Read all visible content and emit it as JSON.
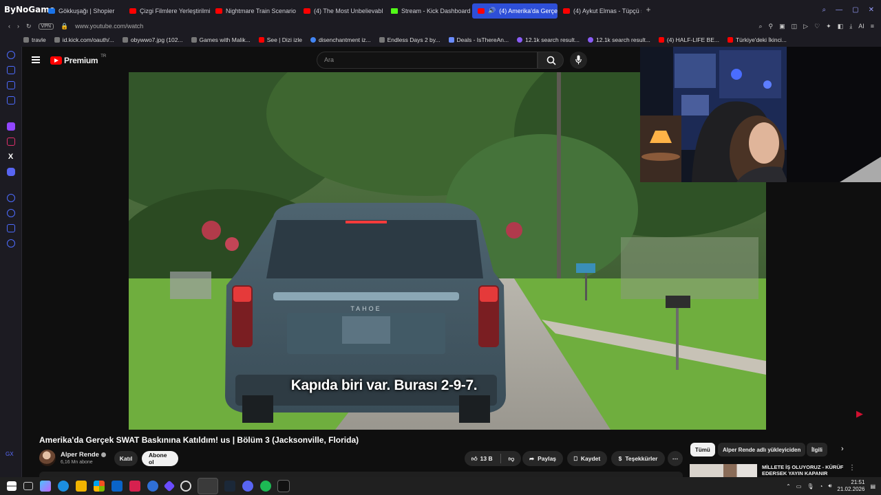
{
  "browser": {
    "brand": "ByNoGame",
    "tabs": [
      {
        "label": "Gökkuşağı | Shopier",
        "icon": "generic-tab-icon"
      },
      {
        "label": "Çizgi Filmlere Yerleştirilmi",
        "icon": "youtube-icon"
      },
      {
        "label": "Nightmare Train Scenario",
        "icon": "youtube-icon"
      },
      {
        "label": "(4) The Most Unbelievabl",
        "icon": "youtube-icon"
      },
      {
        "label": "Stream - Kick Dashboard",
        "icon": "kick-icon"
      },
      {
        "label": "(4) Amerika'da Gerçe",
        "icon": "youtube-icon",
        "active": true
      },
      {
        "label": "(4) Aykut Elmas - Tüpçü s",
        "icon": "youtube-icon"
      }
    ],
    "url": "www.youtube.com/watch",
    "vpn_label": "VPN",
    "ai_label": "AI",
    "bookmarks": [
      {
        "label": "travle",
        "icon": "globe-icon"
      },
      {
        "label": "id.kick.com/oauth/...",
        "icon": "file-icon"
      },
      {
        "label": "obywwo7.jpg (102...",
        "icon": "file-icon"
      },
      {
        "label": "Games with Malik...",
        "icon": "file-icon"
      },
      {
        "label": "See | Dizi izle",
        "icon": "play-icon"
      },
      {
        "label": "disenchantment iz...",
        "icon": "google-icon"
      },
      {
        "label": "Endless Days 2 by...",
        "icon": "file-icon"
      },
      {
        "label": "Deals - IsThereAn...",
        "icon": "tag-icon"
      },
      {
        "label": "12.1k search result...",
        "icon": "search-icon"
      },
      {
        "label": "12.1k search result...",
        "icon": "search-icon"
      },
      {
        "label": "(4) HALF-LIFE BE...",
        "icon": "youtube-icon"
      },
      {
        "label": "Türkiye'deki İkinci...",
        "icon": "youtube-icon"
      }
    ]
  },
  "youtube": {
    "logo_text": "Premium",
    "region": "TR",
    "search_placeholder": "Ara",
    "subtitle": "Kapıda biri var. Burası 2-9-7.",
    "video_title": "Amerika'da Gerçek SWAT Baskınına Katıldım! us | Bölüm 3 (Jacksonville, Florida)",
    "channel": {
      "name": "Alper Rende",
      "subscribers": "6,16 Mn abone"
    },
    "buttons": {
      "join": "Katıl",
      "subscribe": "Abone ol",
      "likes": "13 B",
      "share": "Paylaş",
      "save": "Kaydet",
      "thanks": "Teşekkürler",
      "more": "⋯"
    },
    "chips": [
      "Tümü",
      "Alper Rende adlı yükleyiciden",
      "İlgili"
    ],
    "recommendation": {
      "title": "MİLLETE İŞ OLUYORUZ - KÜRÜF EDERSEK YAYIN KAPANIR"
    }
  },
  "video_scene": {
    "vehicle_badge": "TAHOE"
  },
  "taskbar": {
    "time": "21:51",
    "date": "21.02.2026"
  }
}
